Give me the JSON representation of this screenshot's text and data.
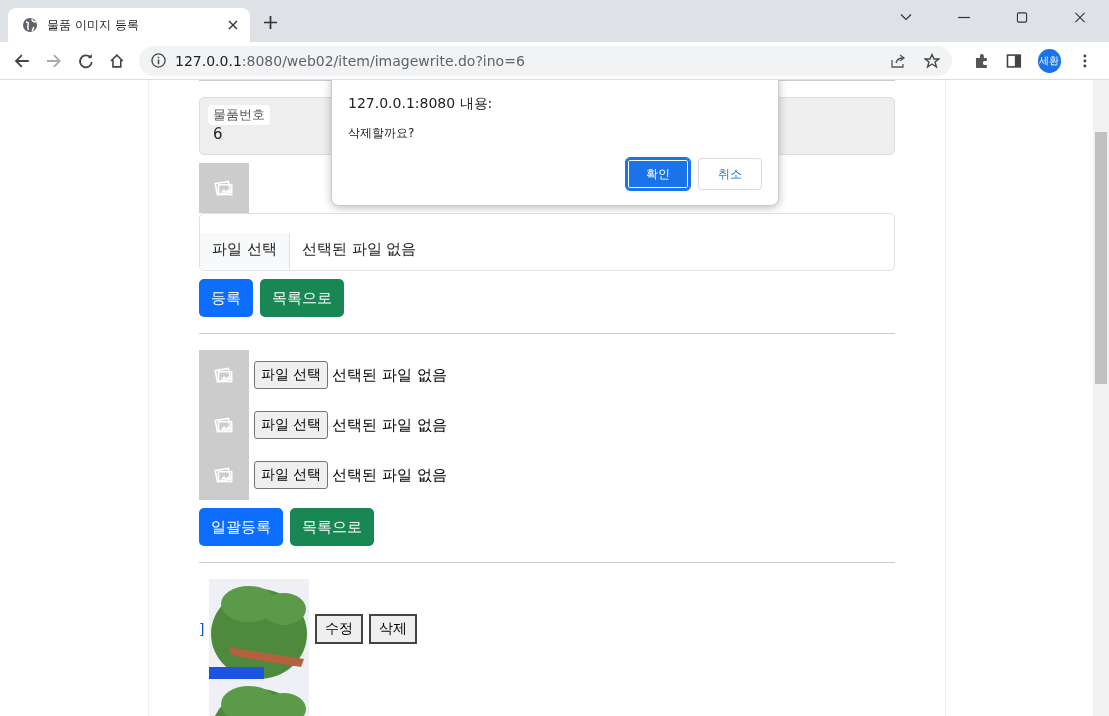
{
  "browser": {
    "tab_title": "물품 이미지 등록",
    "url_host": "127.0.0.1",
    "url_rest": ":8080/web02/item/imagewrite.do?ino=6",
    "profile": "세환"
  },
  "dialog": {
    "title": "127.0.0.1:8080 내용:",
    "message": "삭제할까요?",
    "buttons": [
      {
        "label": "확인",
        "kind": "primary"
      },
      {
        "label": "취소",
        "kind": "secondary"
      }
    ]
  },
  "form": {
    "item_number_label": "물품번호",
    "item_number": "6",
    "file_button": "파일 선택",
    "file_status": "선택된 파일 없음",
    "buttons": [
      {
        "label": "등록",
        "kind": "primary"
      },
      {
        "label": "목록으로",
        "kind": "success"
      }
    ]
  },
  "bulk": {
    "rows": [
      {
        "file_button": "파일 선택",
        "file_status": "선택된 파일 없음"
      },
      {
        "file_button": "파일 선택",
        "file_status": "선택된 파일 없음"
      },
      {
        "file_button": "파일 선택",
        "file_status": "선택된 파일 없음"
      }
    ],
    "buttons": [
      {
        "label": "일괄등록",
        "kind": "primary"
      },
      {
        "label": "목록으로",
        "kind": "success"
      }
    ]
  },
  "images": [
    {
      "kind": "picture",
      "link": "]",
      "actions": [
        "수정",
        "삭제"
      ]
    },
    {
      "kind": "picture"
    }
  ]
}
